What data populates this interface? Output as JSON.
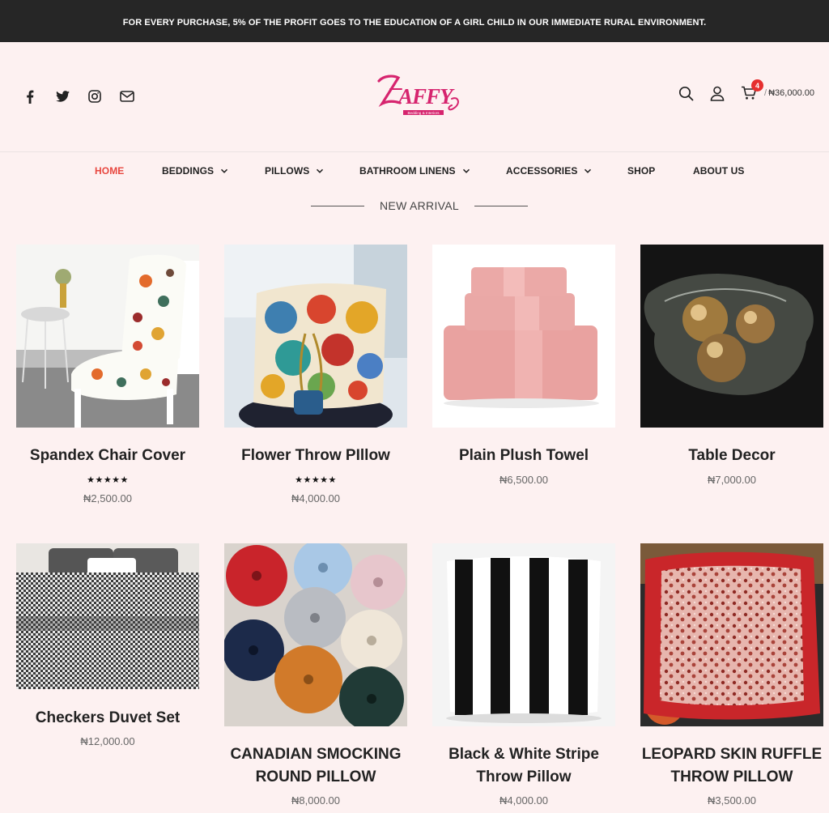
{
  "announcement": "FOR EVERY PURCHASE, 5% OF THE PROFIT GOES TO THE EDUCATION OF A GIRL CHILD IN OUR IMMEDIATE RURAL ENVIRONMENT.",
  "logo": {
    "text": "ZAFFY",
    "tagline": "Bedding & Interiors"
  },
  "social_icons": [
    "facebook-icon",
    "twitter-icon",
    "instagram-icon",
    "mail-icon"
  ],
  "cart": {
    "count": "4",
    "total": "₦36,000.00"
  },
  "nav": {
    "items": [
      {
        "label": "HOME",
        "active": true,
        "dropdown": false
      },
      {
        "label": "BEDDINGS",
        "active": false,
        "dropdown": true
      },
      {
        "label": "PILLOWS",
        "active": false,
        "dropdown": true
      },
      {
        "label": "BATHROOM LINENS",
        "active": false,
        "dropdown": true
      },
      {
        "label": "ACCESSORIES",
        "active": false,
        "dropdown": true
      },
      {
        "label": "SHOP",
        "active": false,
        "dropdown": false
      },
      {
        "label": "ABOUT US",
        "active": false,
        "dropdown": false
      }
    ]
  },
  "section_title": "NEW ARRIVAL",
  "products": [
    {
      "title": "Spandex Chair Cover",
      "rating": "★★★★★",
      "price": "₦2,500.00"
    },
    {
      "title": "Flower Throw PIllow",
      "rating": "★★★★★",
      "price": "₦4,000.00"
    },
    {
      "title": "Plain Plush Towel",
      "price": "₦6,500.00"
    },
    {
      "title": "Table Decor",
      "price": "₦7,000.00"
    },
    {
      "title": "Checkers Duvet Set",
      "price": "₦12,000.00"
    },
    {
      "title": "CANADIAN SMOCKING ROUND PILLOW",
      "price": "₦8,000.00"
    },
    {
      "title": "Black & White Stripe Throw Pillow",
      "price": "₦4,000.00"
    },
    {
      "title": "LEOPARD SKIN RUFFLE THROW PILLOW",
      "price": "₦3,500.00"
    }
  ],
  "colors": {
    "accent": "#e8473f",
    "brand": "#d6246e",
    "topbar": "#262626",
    "page_bg": "#fdf1f1"
  }
}
